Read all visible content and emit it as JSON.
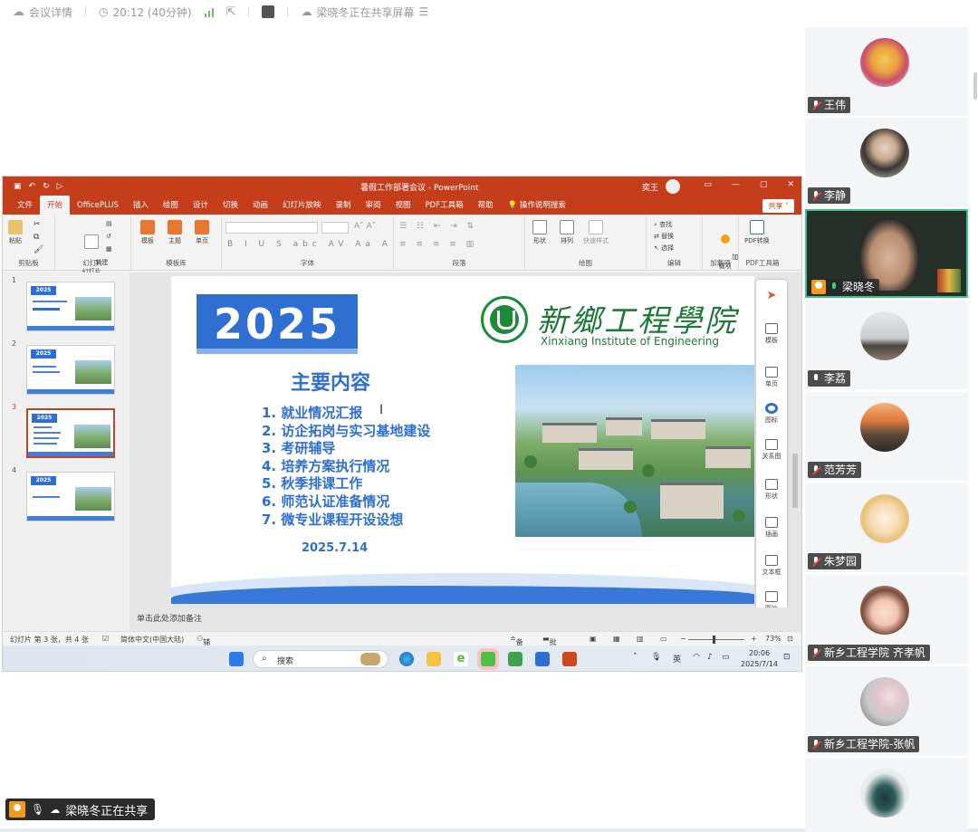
{
  "topbar": {
    "meeting_details": "会议详情",
    "time": "20:12 (40分钟)",
    "sharing_text": "梁晓冬正在共享屏幕"
  },
  "ppt": {
    "title": "暑假工作部署会议  -  PowerPoint",
    "user": "奕王",
    "menu": [
      "文件",
      "开始",
      "OfficePLUS",
      "插入",
      "绘图",
      "设计",
      "切换",
      "动画",
      "幻灯片放映",
      "录制",
      "审阅",
      "视图",
      "PDF工具箱",
      "帮助",
      "操作说明搜索"
    ],
    "share_label": "共享",
    "ribbon": {
      "clipboard": {
        "paste": "粘贴",
        "label": "剪贴板"
      },
      "slides": {
        "new_slide": "新建\n幻灯片",
        "label": "幻灯片"
      },
      "templates": {
        "template": "模板",
        "theme": "主题",
        "single": "单页",
        "label": "模板库"
      },
      "font_label": "字体",
      "paragraph_label": "段落",
      "drawing": {
        "shape": "形状",
        "arrange": "排列",
        "quick_styles": "快速样式",
        "label": "绘图"
      },
      "editing": {
        "find": "查找",
        "replace": "替换",
        "select": "选择",
        "label": "编辑"
      },
      "addins": {
        "addins": "加\n载项",
        "label": "加载项"
      },
      "pdf": {
        "convert": "PDF转换",
        "label": "PDF工具箱"
      }
    },
    "thumbnails": [
      "1",
      "2",
      "3",
      "4"
    ],
    "thumb_badge": "2025",
    "slide": {
      "year": "2025",
      "school_cn": "新鄉工程學院",
      "school_en": "Xinxiang Institute of Engineering",
      "content_title": "主要内容",
      "agenda": [
        "1.  就业情况汇报",
        "2.  访企拓岗与实习基地建设",
        "3.  考研辅导",
        "4.  培养方案执行情况",
        "5.  秋季排课工作",
        "6.  师范认证准备情况",
        "7.  微专业课程开设设想"
      ],
      "date": "2025.7.14"
    },
    "side_panel": [
      "模板",
      "单页",
      "图标",
      "关系图",
      "形状",
      "插画",
      "文本框",
      "图片"
    ],
    "notes_placeholder": "单击此处添加备注",
    "status": {
      "slide_count": "幻灯片 第 3 张，共 4 张",
      "language": "简体中文(中国大陆)",
      "accessibility": "辅助功能: 一切就绪",
      "notes": "备注",
      "comments": "批注",
      "zoom": "73%"
    },
    "taskbar": {
      "search": "搜索",
      "ime": "英",
      "time": "20:06",
      "date": "2025/7/14"
    }
  },
  "share_status": "梁晓冬正在共享",
  "participants": [
    {
      "name": "王伟",
      "avatar": "cartoon-doll"
    },
    {
      "name": "李静",
      "avatar": "woman-photo"
    },
    {
      "name": "梁晓冬",
      "avatar": "live-video",
      "active": true
    },
    {
      "name": "李荔",
      "avatar": "couple-sunset"
    },
    {
      "name": "范芳芳",
      "avatar": "mountain-sunset"
    },
    {
      "name": "朱梦园",
      "avatar": "cartoon-girl"
    },
    {
      "name": "新乡工程学院 齐孝帆",
      "avatar": "anime-girl"
    },
    {
      "name": "新乡工程学院-张帆",
      "avatar": "blossom-tree"
    },
    {
      "name": "",
      "avatar": "standing-person"
    }
  ]
}
